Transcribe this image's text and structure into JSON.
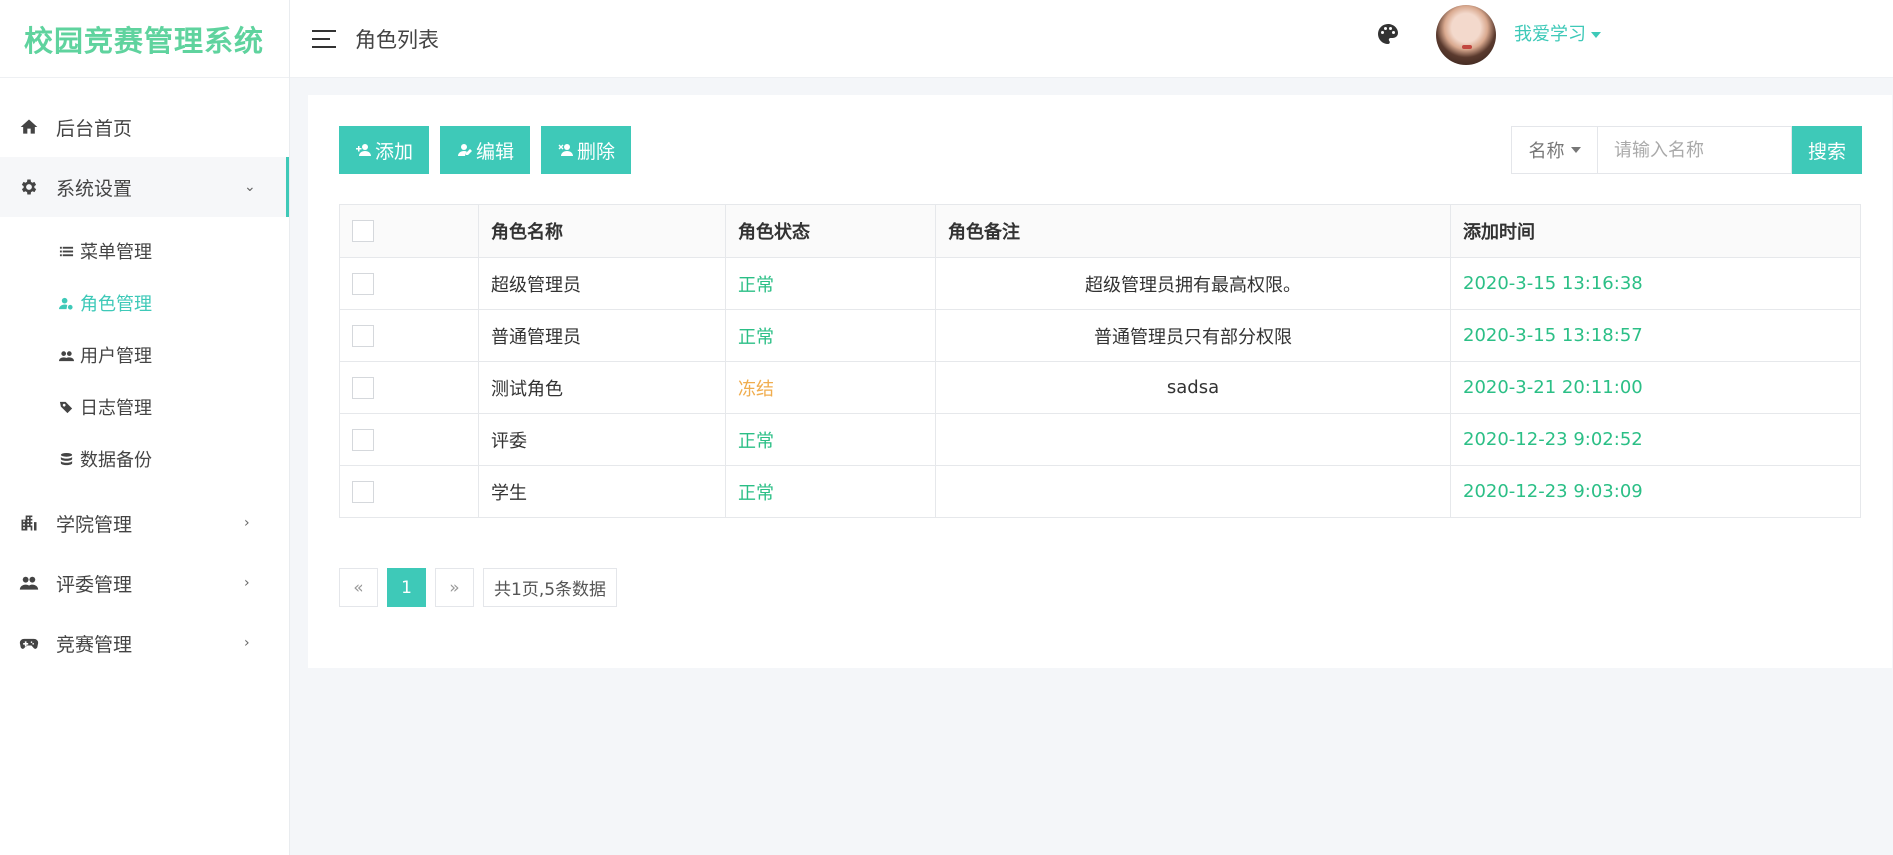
{
  "app": {
    "title": "校园竞赛管理系统"
  },
  "header": {
    "page_title": "角色列表",
    "user_name": "我爱学习"
  },
  "sidebar": {
    "items": [
      {
        "label": "后台首页",
        "icon": "home-icon"
      },
      {
        "label": "系统设置",
        "icon": "gear-icon",
        "expanded": true,
        "children": [
          {
            "label": "菜单管理",
            "icon": "list-icon"
          },
          {
            "label": "角色管理",
            "icon": "user-settings-icon",
            "current": true
          },
          {
            "label": "用户管理",
            "icon": "users-icon"
          },
          {
            "label": "日志管理",
            "icon": "tags-icon"
          },
          {
            "label": "数据备份",
            "icon": "database-icon"
          }
        ]
      },
      {
        "label": "学院管理",
        "icon": "building-icon"
      },
      {
        "label": "评委管理",
        "icon": "users-icon"
      },
      {
        "label": "竞赛管理",
        "icon": "gamepad-icon"
      }
    ]
  },
  "toolbar": {
    "add_label": "添加",
    "edit_label": "编辑",
    "delete_label": "删除"
  },
  "search": {
    "field_label": "名称",
    "placeholder": "请输入名称",
    "button_label": "搜索"
  },
  "table": {
    "headers": [
      "角色名称",
      "角色状态",
      "角色备注",
      "添加时间"
    ],
    "rows": [
      {
        "name": "超级管理员",
        "status": "正常",
        "note": "超级管理员拥有最高权限。",
        "time": "2020-3-15 13:16:38"
      },
      {
        "name": "普通管理员",
        "status": "正常",
        "note": "普通管理员只有部分权限",
        "time": "2020-3-15 13:18:57"
      },
      {
        "name": "测试角色",
        "status": "冻结",
        "note": "sadsa",
        "time": "2020-3-21 20:11:00"
      },
      {
        "name": "评委",
        "status": "正常",
        "note": "",
        "time": "2020-12-23 9:02:52"
      },
      {
        "name": "学生",
        "status": "正常",
        "note": "",
        "time": "2020-12-23 9:03:09"
      }
    ]
  },
  "pagination": {
    "prev": "«",
    "current": "1",
    "next": "»",
    "summary": "共1页,5条数据"
  },
  "colors": {
    "accent": "#3ec9b8",
    "logo": "#5fd39e",
    "status_normal": "#2bbf86",
    "status_frozen": "#f0ad4e"
  }
}
